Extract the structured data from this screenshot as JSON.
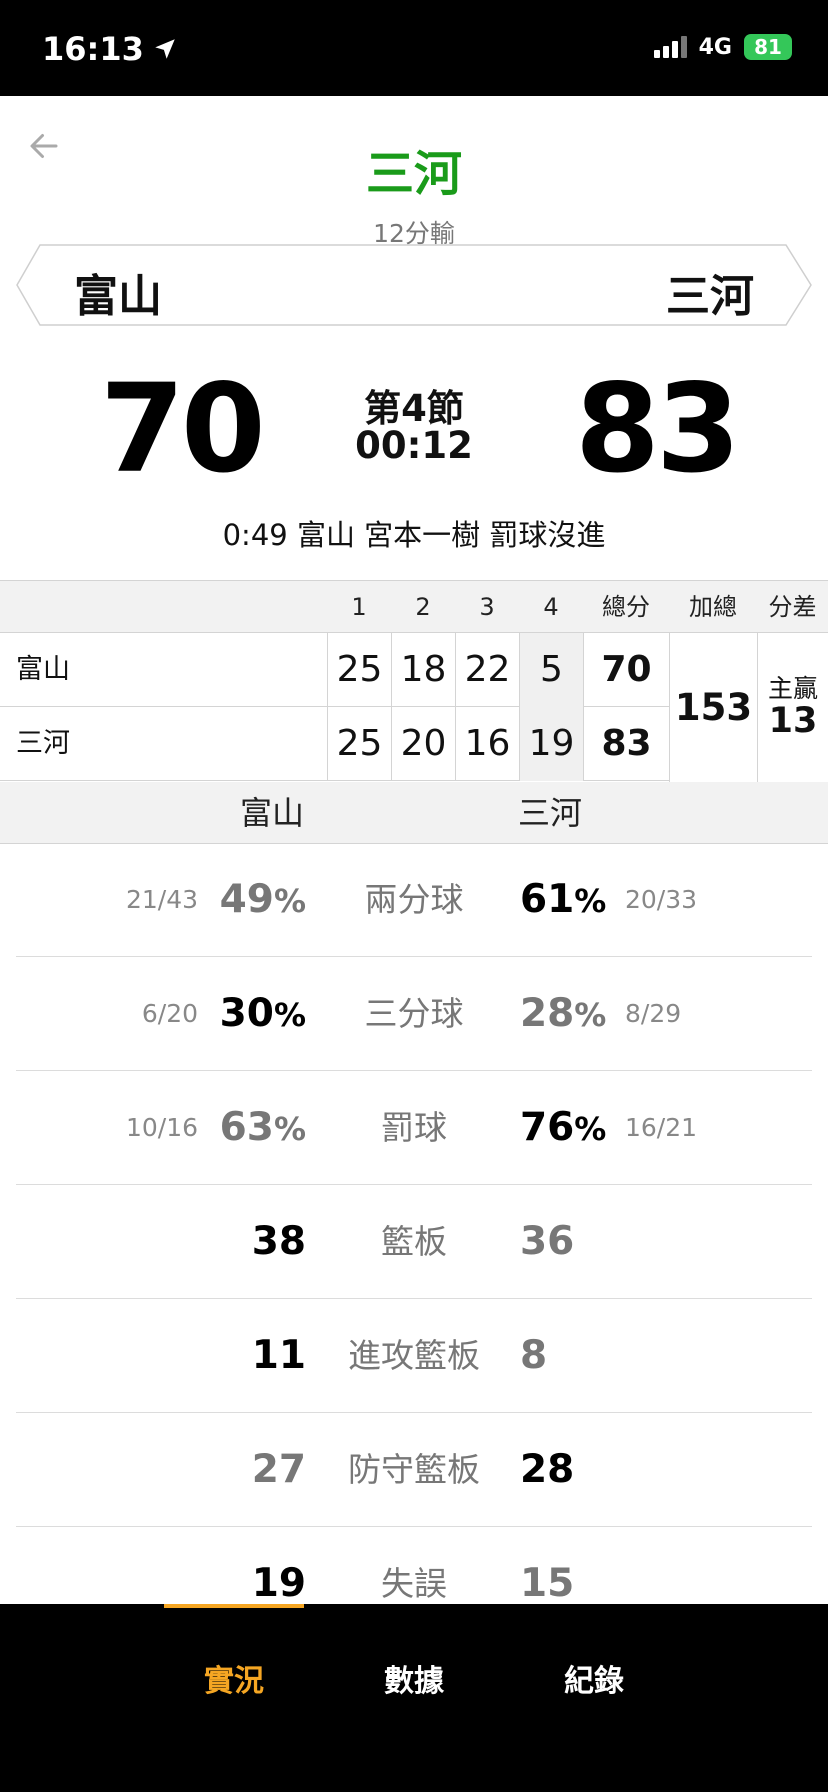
{
  "status": {
    "time": "16:13",
    "network": "4G",
    "battery": "81"
  },
  "header": {
    "winner": "三河",
    "margin": "12分輸"
  },
  "teams": {
    "home": "富山",
    "away": "三河"
  },
  "score": {
    "home": "70",
    "away": "83",
    "period": "第4節",
    "clock": "00:12"
  },
  "last_play": "0:49 富山 宮本一樹 罰球沒進",
  "quarter_table": {
    "headers": {
      "q1": "1",
      "q2": "2",
      "q3": "3",
      "q4": "4",
      "total": "總分",
      "sum": "加總",
      "diff": "分差"
    },
    "rows": [
      {
        "team": "富山",
        "q1": "25",
        "q2": "18",
        "q3": "22",
        "q4": "5",
        "total": "70"
      },
      {
        "team": "三河",
        "q1": "25",
        "q2": "20",
        "q3": "16",
        "q4": "19",
        "total": "83"
      }
    ],
    "sum": "153",
    "diff_label": "主贏",
    "diff_value": "13",
    "sub_home": "富山",
    "sub_away": "三河"
  },
  "stats": [
    {
      "label": "兩分球",
      "home_frac": "21/43",
      "home_num": "49",
      "home_pct": "%",
      "away_num": "61",
      "away_pct": "%",
      "away_frac": "20/33"
    },
    {
      "label": "三分球",
      "home_frac": "6/20",
      "home_num": "30",
      "home_pct": "%",
      "away_num": "28",
      "away_pct": "%",
      "away_frac": "8/29"
    },
    {
      "label": "罰球",
      "home_frac": "10/16",
      "home_num": "63",
      "home_pct": "%",
      "away_num": "76",
      "away_pct": "%",
      "away_frac": "16/21"
    },
    {
      "label": "籃板",
      "home_num": "38",
      "away_num": "36"
    },
    {
      "label": "進攻籃板",
      "home_num": "11",
      "away_num": "8"
    },
    {
      "label": "防守籃板",
      "home_num": "27",
      "away_num": "28"
    },
    {
      "label": "失誤",
      "home_num": "19",
      "away_num": "15"
    }
  ],
  "tabs": {
    "live": "實況",
    "stats": "數據",
    "record": "紀錄"
  },
  "colors": {
    "winner": "#1a9b1a",
    "tab_active": "#f5a623",
    "battery": "#34c759"
  }
}
